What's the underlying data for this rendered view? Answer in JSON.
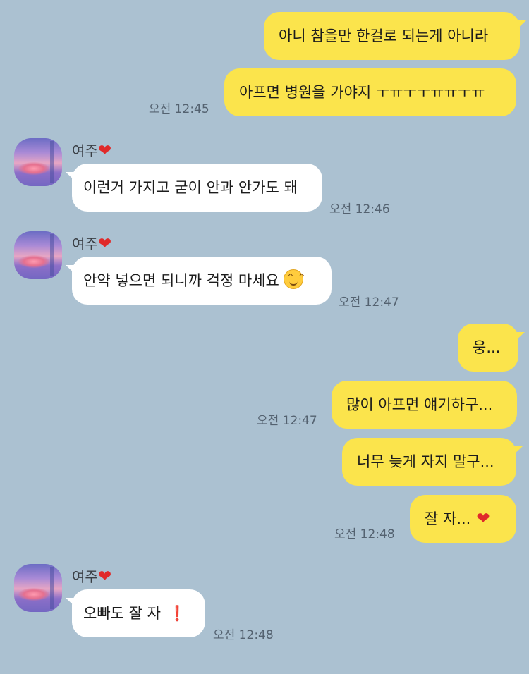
{
  "colors": {
    "background": "#abc1d1",
    "outgoing": "#fbe44c",
    "incoming": "#ffffff"
  },
  "sender": {
    "name": "여주",
    "name_icon": "red-heart-icon"
  },
  "messages": {
    "m1": {
      "text": "아니 참을만 한걸로 되는게 아니라"
    },
    "m2": {
      "text": "아프면 병원을 가야지 ㅜㅠㅜㅜㅠㅠㅜㅠ",
      "time": "오전 12:45"
    },
    "m3": {
      "text": "이런거 가지고 굳이 안과 안가도 돼",
      "time": "오전 12:46"
    },
    "m4": {
      "text": "안약 넣으면 되니까 걱정 마세요",
      "time": "오전 12:47",
      "icon": "smiling-face-icon"
    },
    "m5": {
      "text": "웅..."
    },
    "m6": {
      "text": "많이 아프면 얘기하구...",
      "time": "오전 12:47"
    },
    "m7": {
      "text": "너무 늦게 자지 말구..."
    },
    "m8": {
      "text": "잘 자...",
      "time": "오전 12:48",
      "icon": "red-heart-icon"
    },
    "m9": {
      "text": "오빠도 잘 자",
      "time": "오전 12:48",
      "icon": "exclamation-icon"
    }
  }
}
